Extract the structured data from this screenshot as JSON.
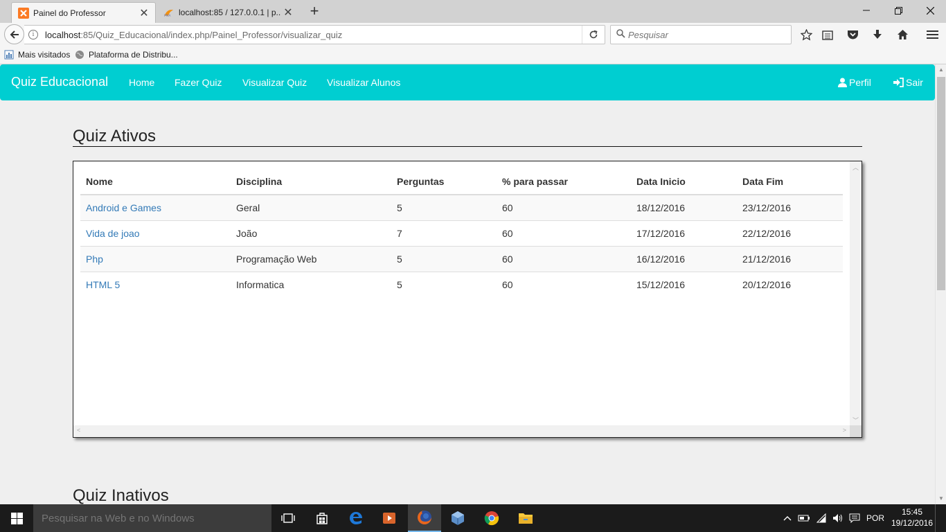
{
  "browser": {
    "tabs": [
      {
        "title": "Painel do Professor",
        "active": true
      },
      {
        "title": "localhost:85 / 127.0.0.1 | p...",
        "active": false
      }
    ],
    "url_prefix": "localhost",
    "url_rest": ":85/Quiz_Educacional/index.php/Painel_Professor/visualizar_quiz",
    "search_placeholder": "Pesquisar",
    "bookmarks": [
      "Mais visitados",
      "Plataforma de Distribu..."
    ]
  },
  "navbar": {
    "brand": "Quiz Educacional",
    "links": [
      "Home",
      "Fazer Quiz",
      "Visualizar Quiz",
      "Visualizar Alunos"
    ],
    "profile_label": "Perfil",
    "logout_label": "Sair",
    "color": "#00ced1"
  },
  "active_section": {
    "title": "Quiz Ativos",
    "columns": [
      "Nome",
      "Disciplina",
      "Perguntas",
      "% para passar",
      "Data Inicio",
      "Data Fim"
    ],
    "rows": [
      [
        "Android e Games",
        "Geral",
        "5",
        "60",
        "18/12/2016",
        "23/12/2016"
      ],
      [
        "Vida de joao",
        "João",
        "7",
        "60",
        "17/12/2016",
        "22/12/2016"
      ],
      [
        "Php",
        "Programação Web",
        "5",
        "60",
        "16/12/2016",
        "21/12/2016"
      ],
      [
        "HTML 5",
        "Informatica",
        "5",
        "60",
        "15/12/2016",
        "20/12/2016"
      ]
    ]
  },
  "inactive_section": {
    "title": "Quiz Inativos"
  },
  "taskbar": {
    "search_placeholder": "Pesquisar na Web e no Windows",
    "language": "POR",
    "time": "15:45",
    "date": "19/12/2016"
  }
}
